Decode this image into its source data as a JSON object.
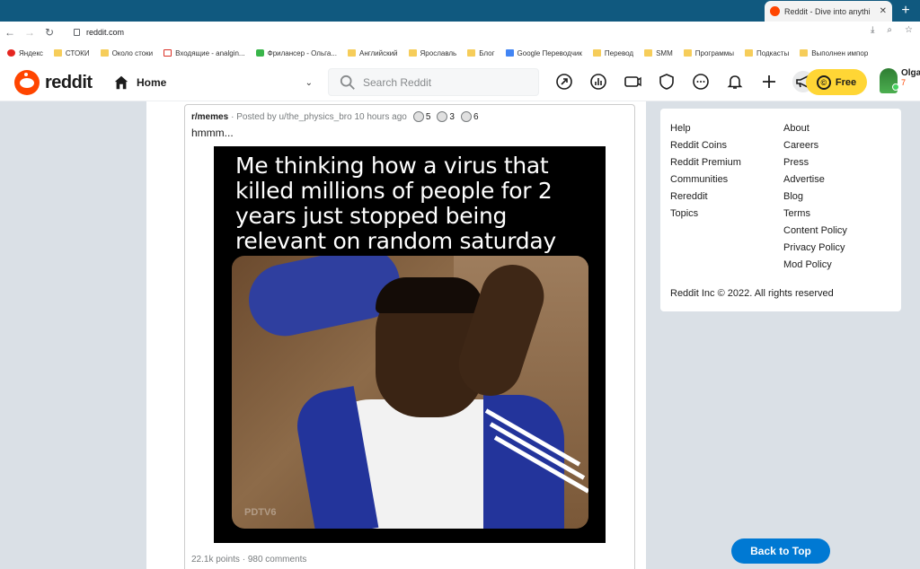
{
  "browser": {
    "tab_title": "Reddit - Dive into anything",
    "url": "reddit.com",
    "bookmarks": [
      {
        "label": "Яндекс",
        "icon": "yandex-icon"
      },
      {
        "label": "СТОКИ",
        "icon": "folder-icon"
      },
      {
        "label": "Около стоки",
        "icon": "folder-icon"
      },
      {
        "label": "Входящие - analgin...",
        "icon": "gmail-icon"
      },
      {
        "label": "Фрилансер - Ольга...",
        "icon": "fl-icon"
      },
      {
        "label": "Английский",
        "icon": "folder-icon"
      },
      {
        "label": "Ярославль",
        "icon": "folder-icon"
      },
      {
        "label": "Блог",
        "icon": "folder-icon"
      },
      {
        "label": "Google Переводчик",
        "icon": "google-translate-icon"
      },
      {
        "label": "Перевод",
        "icon": "folder-icon"
      },
      {
        "label": "SMM",
        "icon": "folder-icon"
      },
      {
        "label": "Программы",
        "icon": "folder-icon"
      },
      {
        "label": "Подкасты",
        "icon": "folder-icon"
      },
      {
        "label": "Выполнен импор",
        "icon": "folder-icon"
      }
    ]
  },
  "header": {
    "logo_text": "reddit",
    "home_label": "Home",
    "search_placeholder": "Search Reddit",
    "free_label": "Free",
    "coin_symbol": "©",
    "user_name": "Olga",
    "karma": "7"
  },
  "post": {
    "subreddit": "r/memes",
    "posted_by": "· Posted by u/the_physics_bro 10 hours ago",
    "awards": [
      "5",
      "3",
      "6"
    ],
    "title": "hmmm...",
    "meme_caption": "Me thinking how a virus that killed millions of people for 2 years just stopped being relevant on random saturday",
    "watermark": "PDTV6",
    "points": "22.1k points",
    "comments": "· 980 comments"
  },
  "sidebar": {
    "col1": [
      "Help",
      "Reddit Coins",
      "Reddit Premium",
      "Communities",
      "Rereddit",
      "Topics"
    ],
    "col2": [
      "About",
      "Careers",
      "Press",
      "Advertise",
      "Blog",
      "Terms",
      "Content Policy",
      "Privacy Policy",
      "Mod Policy"
    ],
    "copyright": "Reddit Inc © 2022. All rights reserved"
  },
  "back_to_top": "Back to Top",
  "colors": {
    "brand": "#ff4500",
    "accent": "#0079d3",
    "premium": "#ffd635",
    "tabbar": "#10597f"
  }
}
